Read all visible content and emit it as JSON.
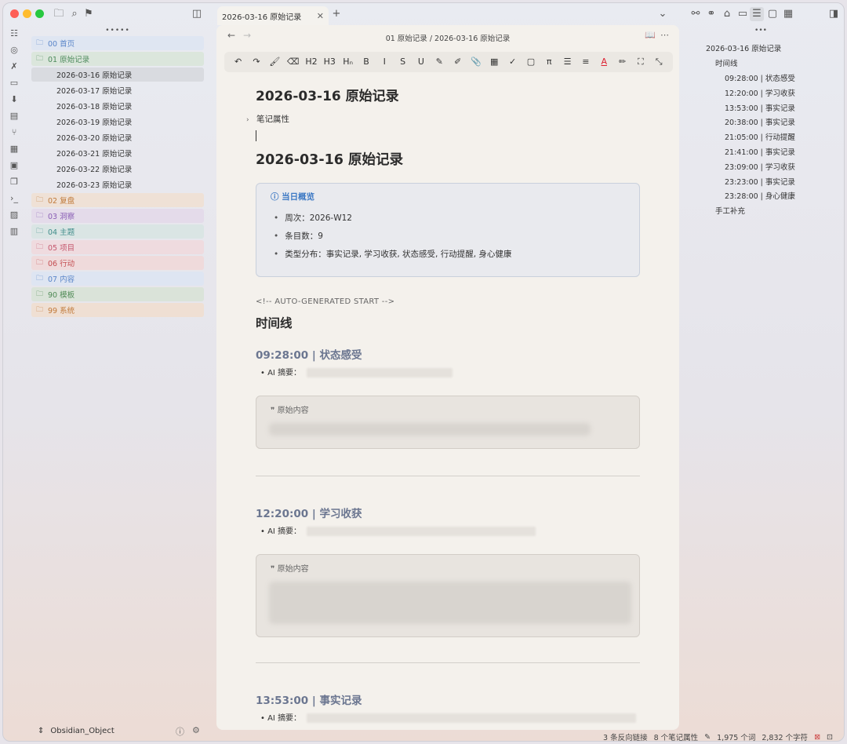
{
  "tab": {
    "title": "2026-03-16 原始记录",
    "close": "✕",
    "new": "+"
  },
  "nav": {
    "back": "←",
    "forward": "→",
    "breadcrumb": "01 原始记录 / 2026-03-16 原始记录",
    "reading_view": "📖",
    "more": "⋯"
  },
  "toolbar": [
    "↶",
    "↷",
    "🖌",
    "⌫",
    "H2",
    "H3",
    "Hₙ",
    "B",
    "I",
    "S",
    "U",
    "✎",
    "✐",
    "📎",
    "▦",
    "✓",
    "▢",
    "π",
    "☰",
    "≡",
    "A",
    "✏",
    "⛶",
    "⤡"
  ],
  "sidebar": {
    "grip": "•••••",
    "folders_top": [
      {
        "label": "00 首页",
        "bg": "#dfe6f2",
        "color": "#5b86c9"
      },
      {
        "label": "01 原始记录",
        "bg": "#dbe6dc",
        "color": "#4d8a5c"
      }
    ],
    "files": [
      "2026-03-16 原始记录",
      "2026-03-17 原始记录",
      "2026-03-18 原始记录",
      "2026-03-19 原始记录",
      "2026-03-20 原始记录",
      "2026-03-21 原始记录",
      "2026-03-22 原始记录",
      "2026-03-23 原始记录"
    ],
    "folders_bottom": [
      {
        "label": "02 复盘",
        "bg": "#efe1d6",
        "color": "#c07a3a"
      },
      {
        "label": "03 洞察",
        "bg": "#e4dbea",
        "color": "#8a5fb5"
      },
      {
        "label": "04 主题",
        "bg": "#dae5e4",
        "color": "#3f8c8a"
      },
      {
        "label": "05 项目",
        "bg": "#efdbdf",
        "color": "#c4576d"
      },
      {
        "label": "06 行动",
        "bg": "#efdadb",
        "color": "#c44e52"
      },
      {
        "label": "07 内容",
        "bg": "#dee5f2",
        "color": "#5b86c9"
      },
      {
        "label": "90 模板",
        "bg": "#dae3d9",
        "color": "#4f8a55"
      },
      {
        "label": "99 系统",
        "bg": "#efdfd3",
        "color": "#c17a3a"
      }
    ],
    "vault_name": "Obsidian_Object"
  },
  "doc": {
    "title": "2026-03-16 原始记录",
    "properties": "笔记属性",
    "heading": "2026-03-16 原始记录",
    "callout": {
      "title": "当日概览",
      "items": [
        "周次：2026-W12",
        "条目数：9",
        "类型分布：事实记录, 学习收获, 状态感受, 行动提醒, 身心健康"
      ]
    },
    "comment": "<!-- AUTO-GENERATED START -->",
    "section": "时间线",
    "summary_label": "AI 摘要：",
    "quote_label": "原始内容",
    "entries": [
      "09:28:00 | 状态感受",
      "12:20:00 | 学习收获",
      "13:53:00 | 事实记录"
    ]
  },
  "outline": {
    "grip": "•••",
    "title": "2026-03-16 原始记录",
    "section": "时间线",
    "items": [
      "09:28:00 | 状态感受",
      "12:20:00 | 学习收获",
      "13:53:00 | 事实记录",
      "20:38:00 | 事实记录",
      "21:05:00 | 行动提醒",
      "21:41:00 | 事实记录",
      "23:09:00 | 学习收获",
      "23:23:00 | 事实记录",
      "23:28:00 | 身心健康"
    ],
    "extra": "手工补充"
  },
  "status": {
    "backlinks": "3 条反向链接",
    "properties": "8 个笔记属性",
    "words": "1,975 个词",
    "chars": "2,832 个字符"
  }
}
